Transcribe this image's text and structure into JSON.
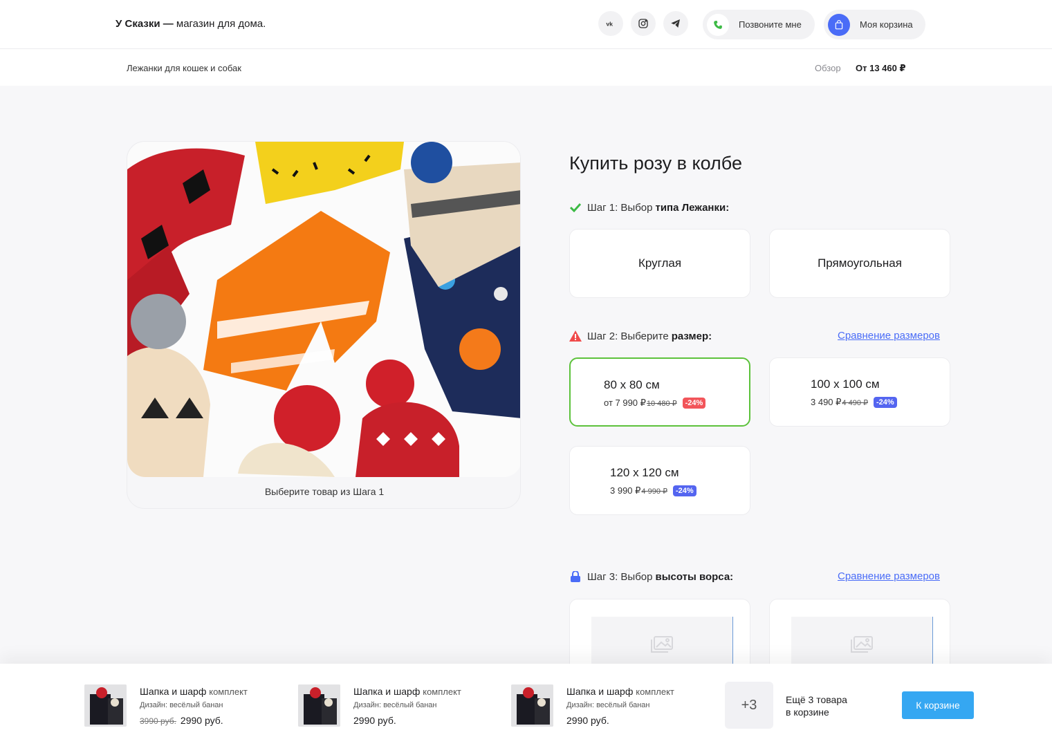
{
  "header": {
    "brand_name": "У Сказки —",
    "brand_tagline": "магазин для дома.",
    "social": [
      "vk-icon",
      "instagram-icon",
      "telegram-icon"
    ],
    "call_label": "Позвоните мне",
    "cart_label": "Моя корзина"
  },
  "subnav": {
    "crumb": "Лежанки для кошек и собак",
    "overview": "Обзор",
    "price": "От 13 460 ₽"
  },
  "gallery": {
    "caption": "Выберите товар из Шага 1"
  },
  "product": {
    "title": "Купить розу в колбе",
    "step1": {
      "prefix": "Шаг 1: Выбор",
      "bold": "типа Лежанки:",
      "options": [
        "Круглая",
        "Прямоугольная"
      ]
    },
    "step2": {
      "prefix": "Шаг 2: Выберите",
      "bold": "размер:",
      "link": "Сравнение размеров",
      "sizes": [
        {
          "label": "80 х 80 см",
          "price": "от 7 990 ₽",
          "old": "10 480 ₽",
          "discount": "-24%",
          "selected": true,
          "badge_color": "#f2555a"
        },
        {
          "label": "100 х 100 см",
          "price": "3 490 ₽",
          "old": "4 490 ₽",
          "discount": "-24%",
          "selected": false,
          "badge_color": "#5465f0"
        },
        {
          "label": "120 х 120 см",
          "price": "3 990 ₽",
          "old": "4 990 ₽",
          "discount": "-24%",
          "selected": false,
          "badge_color": "#5465f0"
        }
      ]
    },
    "step3": {
      "prefix": "Шаг 3: Выбор",
      "bold": "высоты ворса:",
      "link": "Сравнение размеров"
    }
  },
  "cart_bar": {
    "items": [
      {
        "name": "Шапка и шарф",
        "kind": "комплект",
        "design": "Дизайн: весёлый банан",
        "old_price": "3990 руб.",
        "price": "2990 руб."
      },
      {
        "name": "Шапка и шарф",
        "kind": "комплект",
        "design": "Дизайн: весёлый банан",
        "old_price": "",
        "price": "2990 руб."
      },
      {
        "name": "Шапка и шарф",
        "kind": "комплект",
        "design": "Дизайн: весёлый банан",
        "old_price": "",
        "price": "2990 руб."
      }
    ],
    "more_count": "+3",
    "more_text_1": "Ещё 3 товара",
    "more_text_2": "в корзине",
    "button_label": "К корзине"
  },
  "colors": {
    "accent_blue": "#4a6cf7",
    "selected_green": "#5cc23b",
    "cart_button": "#35a7f2",
    "check_green": "#3cba45",
    "warn_red": "#f04a4a"
  }
}
